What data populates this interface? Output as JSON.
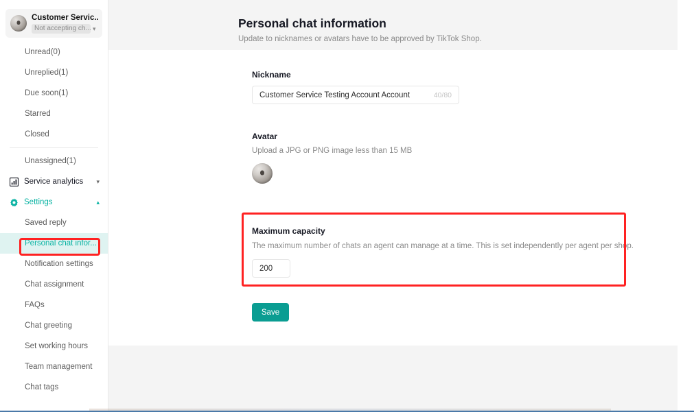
{
  "sidebar": {
    "account": {
      "name": "Customer Servic...",
      "status": "Not accepting ch...",
      "caret_icon": "chevron-down-icon",
      "avatar_icon": "avatar-sphere-image"
    },
    "filters": [
      {
        "label": "Unread(0)"
      },
      {
        "label": "Unreplied(1)"
      },
      {
        "label": "Due soon(1)"
      },
      {
        "label": "Starred"
      },
      {
        "label": "Closed"
      }
    ],
    "unassigned": {
      "label": "Unassigned(1)"
    },
    "groups": [
      {
        "label": "Service analytics",
        "icon": "bar-chart-icon",
        "expanded": false,
        "chevron": "chevron-down-icon",
        "items": []
      },
      {
        "label": "Settings",
        "icon": "gear-icon",
        "expanded": true,
        "chevron": "chevron-up-icon",
        "items": [
          {
            "label": "Saved reply",
            "selected": false
          },
          {
            "label": "Personal chat infor...",
            "selected": true
          },
          {
            "label": "Notification settings",
            "selected": false
          },
          {
            "label": "Chat assignment",
            "selected": false
          },
          {
            "label": "FAQs",
            "selected": false
          },
          {
            "label": "Chat greeting",
            "selected": false
          },
          {
            "label": "Set working hours",
            "selected": false
          },
          {
            "label": "Team management",
            "selected": false
          },
          {
            "label": "Chat tags",
            "selected": false
          }
        ]
      }
    ]
  },
  "main": {
    "title": "Personal chat information",
    "subtitle": "Update to nicknames or avatars have to be approved by TikTok Shop.",
    "nickname": {
      "label": "Nickname",
      "value": "Customer Service Testing Account Account",
      "counter": "40/80"
    },
    "avatar": {
      "label": "Avatar",
      "description": "Upload a JPG or PNG image less than 15 MB",
      "image_icon": "avatar-sphere-image"
    },
    "capacity": {
      "label": "Maximum capacity",
      "description": "The maximum number of chats an agent can manage at a time. This is set independently per agent per shop.",
      "value": "200"
    },
    "save_label": "Save"
  },
  "colors": {
    "accent_teal": "#0ab3a3",
    "save_teal": "#0a9d92",
    "selected_bg": "#dff3f1",
    "highlight_red": "#ff2222",
    "band_grey": "#f4f4f4"
  }
}
